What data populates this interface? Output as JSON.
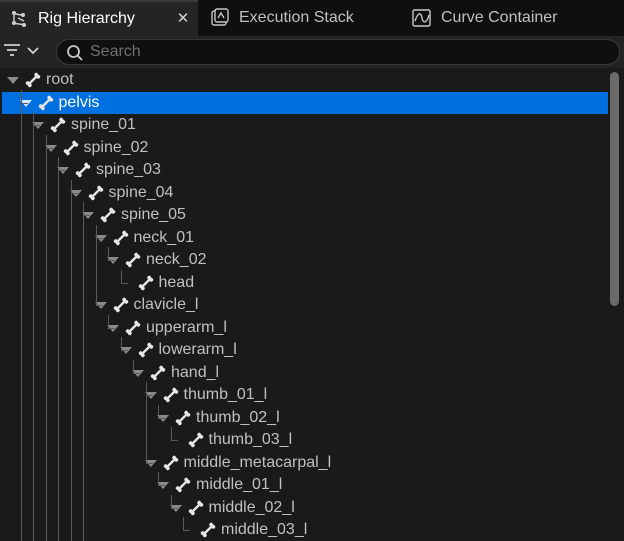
{
  "tabs": [
    {
      "label": "Rig Hierarchy",
      "icon": "rig-hierarchy-icon",
      "active": true,
      "close": "✕"
    },
    {
      "label": "Execution Stack",
      "icon": "execution-stack-icon",
      "active": false
    },
    {
      "label": "Curve Container",
      "icon": "curve-container-icon",
      "active": false
    }
  ],
  "toolbar": {
    "filter_icon": "filter-icon",
    "search": {
      "placeholder": "Search",
      "value": ""
    }
  },
  "tree": {
    "icon": "bone-icon",
    "selected_color": "#0070e0",
    "rows": [
      {
        "label": "root",
        "depth": 0,
        "expanded": true
      },
      {
        "label": "pelvis",
        "depth": 1,
        "expanded": true,
        "selected": true
      },
      {
        "label": "spine_01",
        "depth": 2,
        "expanded": true
      },
      {
        "label": "spine_02",
        "depth": 3,
        "expanded": true
      },
      {
        "label": "spine_03",
        "depth": 4,
        "expanded": true
      },
      {
        "label": "spine_04",
        "depth": 5,
        "expanded": true
      },
      {
        "label": "spine_05",
        "depth": 6,
        "expanded": true
      },
      {
        "label": "neck_01",
        "depth": 7,
        "expanded": true
      },
      {
        "label": "neck_02",
        "depth": 8,
        "expanded": true
      },
      {
        "label": "head",
        "depth": 9,
        "expanded": false
      },
      {
        "label": "clavicle_l",
        "depth": 7,
        "expanded": true
      },
      {
        "label": "upperarm_l",
        "depth": 8,
        "expanded": true
      },
      {
        "label": "lowerarm_l",
        "depth": 9,
        "expanded": true
      },
      {
        "label": "hand_l",
        "depth": 10,
        "expanded": true
      },
      {
        "label": "thumb_01_l",
        "depth": 11,
        "expanded": true
      },
      {
        "label": "thumb_02_l",
        "depth": 12,
        "expanded": true
      },
      {
        "label": "thumb_03_l",
        "depth": 13,
        "expanded": false
      },
      {
        "label": "middle_metacarpal_l",
        "depth": 11,
        "expanded": true
      },
      {
        "label": "middle_01_l",
        "depth": 12,
        "expanded": true
      },
      {
        "label": "middle_02_l",
        "depth": 13,
        "expanded": true
      },
      {
        "label": "middle_03_l",
        "depth": 14,
        "expanded": false
      }
    ]
  }
}
